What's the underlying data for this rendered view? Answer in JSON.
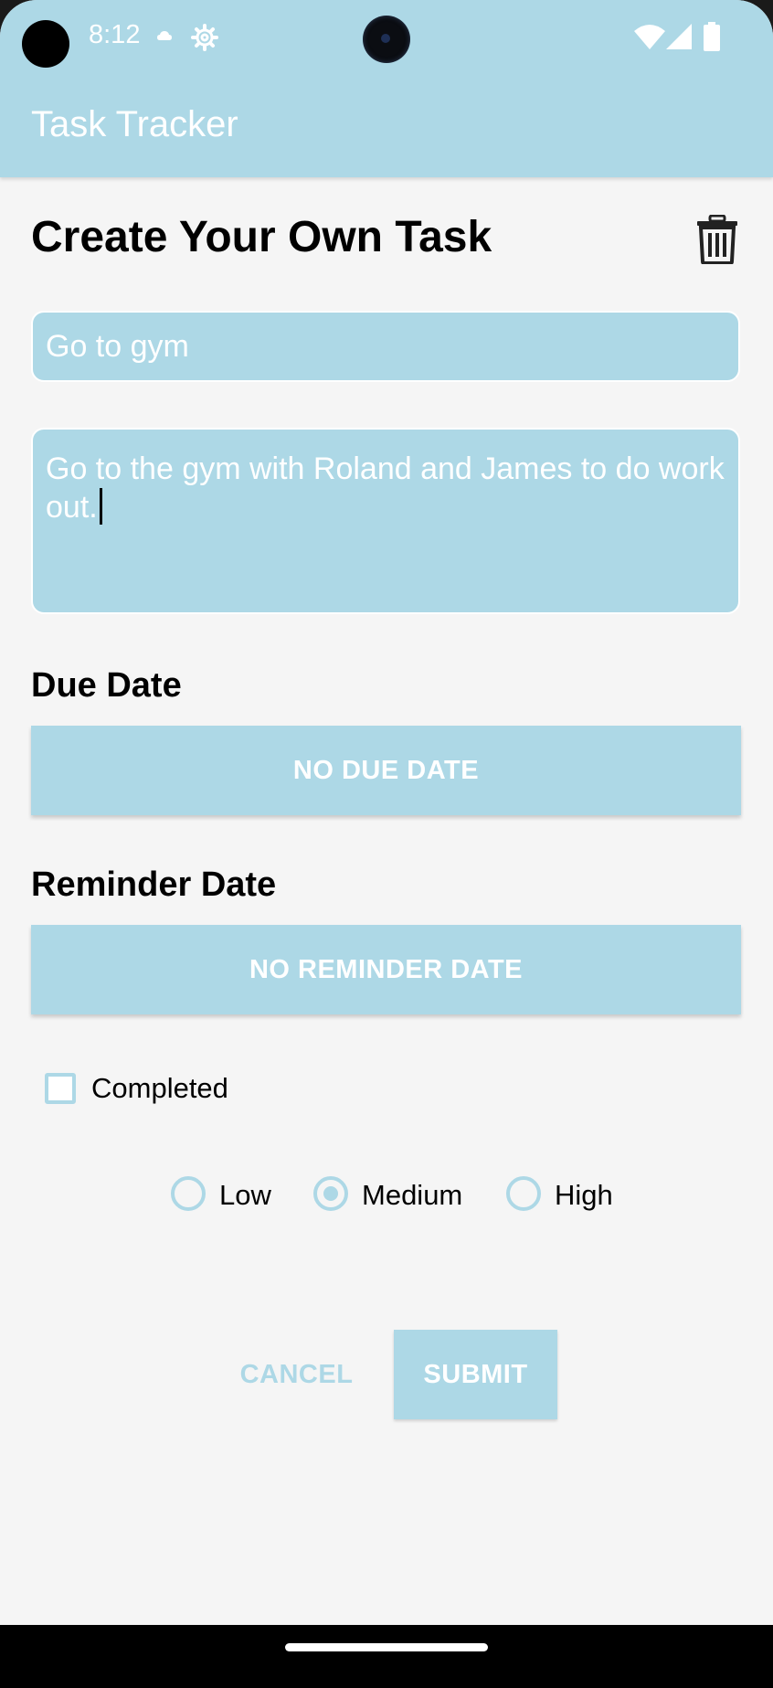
{
  "status_bar": {
    "time": "8:12",
    "icons": [
      "cloud-icon",
      "settings-gear-icon",
      "wifi-icon",
      "signal-icon",
      "battery-icon"
    ]
  },
  "app_bar": {
    "title": "Task Tracker"
  },
  "page": {
    "heading": "Create Your Own Task",
    "delete_icon": "trash-icon"
  },
  "form": {
    "title_value": "Go to gym",
    "description_value": "Go to the gym with Roland and James to do work out.",
    "due_date": {
      "label": "Due Date",
      "button": "NO DUE DATE"
    },
    "reminder_date": {
      "label": "Reminder Date",
      "button": "NO REMINDER DATE"
    },
    "completed": {
      "label": "Completed",
      "checked": false
    },
    "priority": {
      "options": [
        "Low",
        "Medium",
        "High"
      ],
      "selected": "Medium"
    },
    "cancel_label": "CANCEL",
    "submit_label": "SUBMIT"
  },
  "colors": {
    "accent": "#add8e6",
    "background": "#f5f5f5",
    "text": "#000000"
  }
}
